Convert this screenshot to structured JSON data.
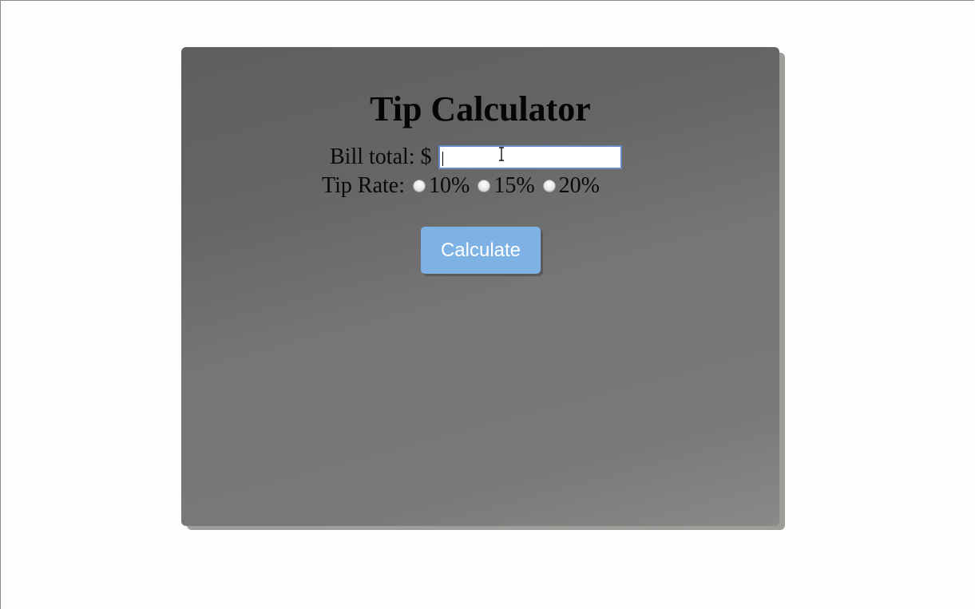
{
  "app": {
    "title": "Tip Calculator"
  },
  "form": {
    "bill_label": "Bill total: $",
    "bill_value": "",
    "tip_label": "Tip Rate:",
    "tip_options": [
      {
        "label": "10%",
        "checked": false
      },
      {
        "label": "15%",
        "checked": false
      },
      {
        "label": "20%",
        "checked": false
      }
    ],
    "calculate_label": "Calculate"
  },
  "colors": {
    "button": "#7eb1e4",
    "input_border": "#6a8ac8"
  }
}
